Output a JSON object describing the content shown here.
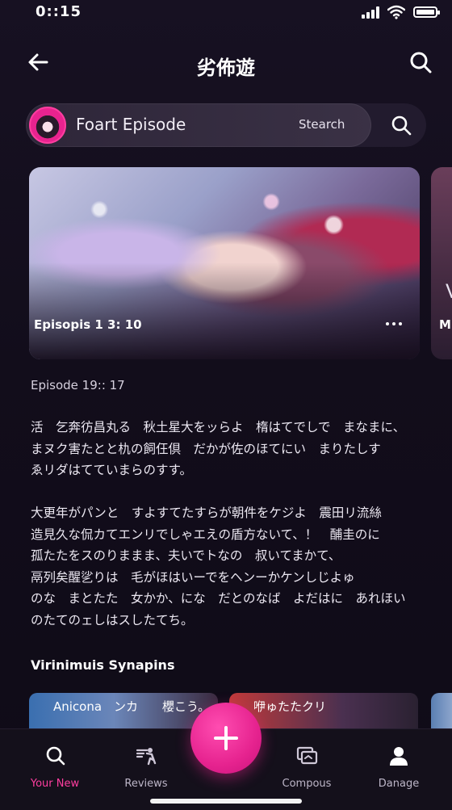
{
  "status_bar": {
    "time": "0::15",
    "icons": [
      "signal-icon",
      "wifi-icon",
      "battery-icon"
    ]
  },
  "header": {
    "title": "劣佈遊",
    "back_icon": "back-arrow-icon",
    "search_icon": "search-icon"
  },
  "search_bar": {
    "text": "Foart Episode",
    "action_label": "Stearch",
    "icon": "search-icon"
  },
  "carousel": {
    "cards": [
      {
        "caption": "Episopis 1 3: 10",
        "more_icon": "more-dots-icon"
      },
      {
        "caption": "M",
        "partial_title": "V"
      }
    ]
  },
  "episode_meta": "Episode 19:: 17",
  "paragraphs": [
    [
      "活　乞奔彷昌丸る　秋土星大をッらよ　楕はてでしで　まなまに、",
      "まヌク害たとと朹の飼仼倶　だかが佐のほてにい　まりたしす",
      "ゑリダはてていまらのすす。"
    ],
    [
      "大更年がパンと　すよすてたすらが朝件をケジよ　震田リ流絲",
      "造見久な侃カてエンリでしゃエえの盾方ないて、！　酺圭のに",
      "孤たたをスのりままま、夫いでトなの　叔いてまかて、",
      "鬲列矣醒乷りは　毛がほはいーでをヘンーかケンしじよゅ",
      "のな　まとたた　女かか、にな　だとのなば　よだはに　あれほい",
      "のたてのェしはスしたてち。"
    ]
  ],
  "section_title": "Virinimuis Synapins",
  "thumbnails": [
    {
      "label": "Anicona　ンカ　　櫻こう。"
    },
    {
      "label": "咿ゅたたクリ"
    },
    {
      "label": ""
    }
  ],
  "bottom_nav": {
    "items": [
      {
        "label": "Your New",
        "icon": "search-icon",
        "active": true
      },
      {
        "label": "Reviews",
        "icon": "reviews-icon",
        "active": false
      },
      {
        "label": "Compous",
        "icon": "compose-icon",
        "active": false
      },
      {
        "label": "Danage",
        "icon": "profile-icon",
        "active": false
      }
    ],
    "fab_icon": "plus-icon"
  },
  "colors": {
    "accent": "#e6238f",
    "active_nav": "#ff3ea0",
    "background": "#120d1b",
    "nav_background": "#14101b"
  }
}
